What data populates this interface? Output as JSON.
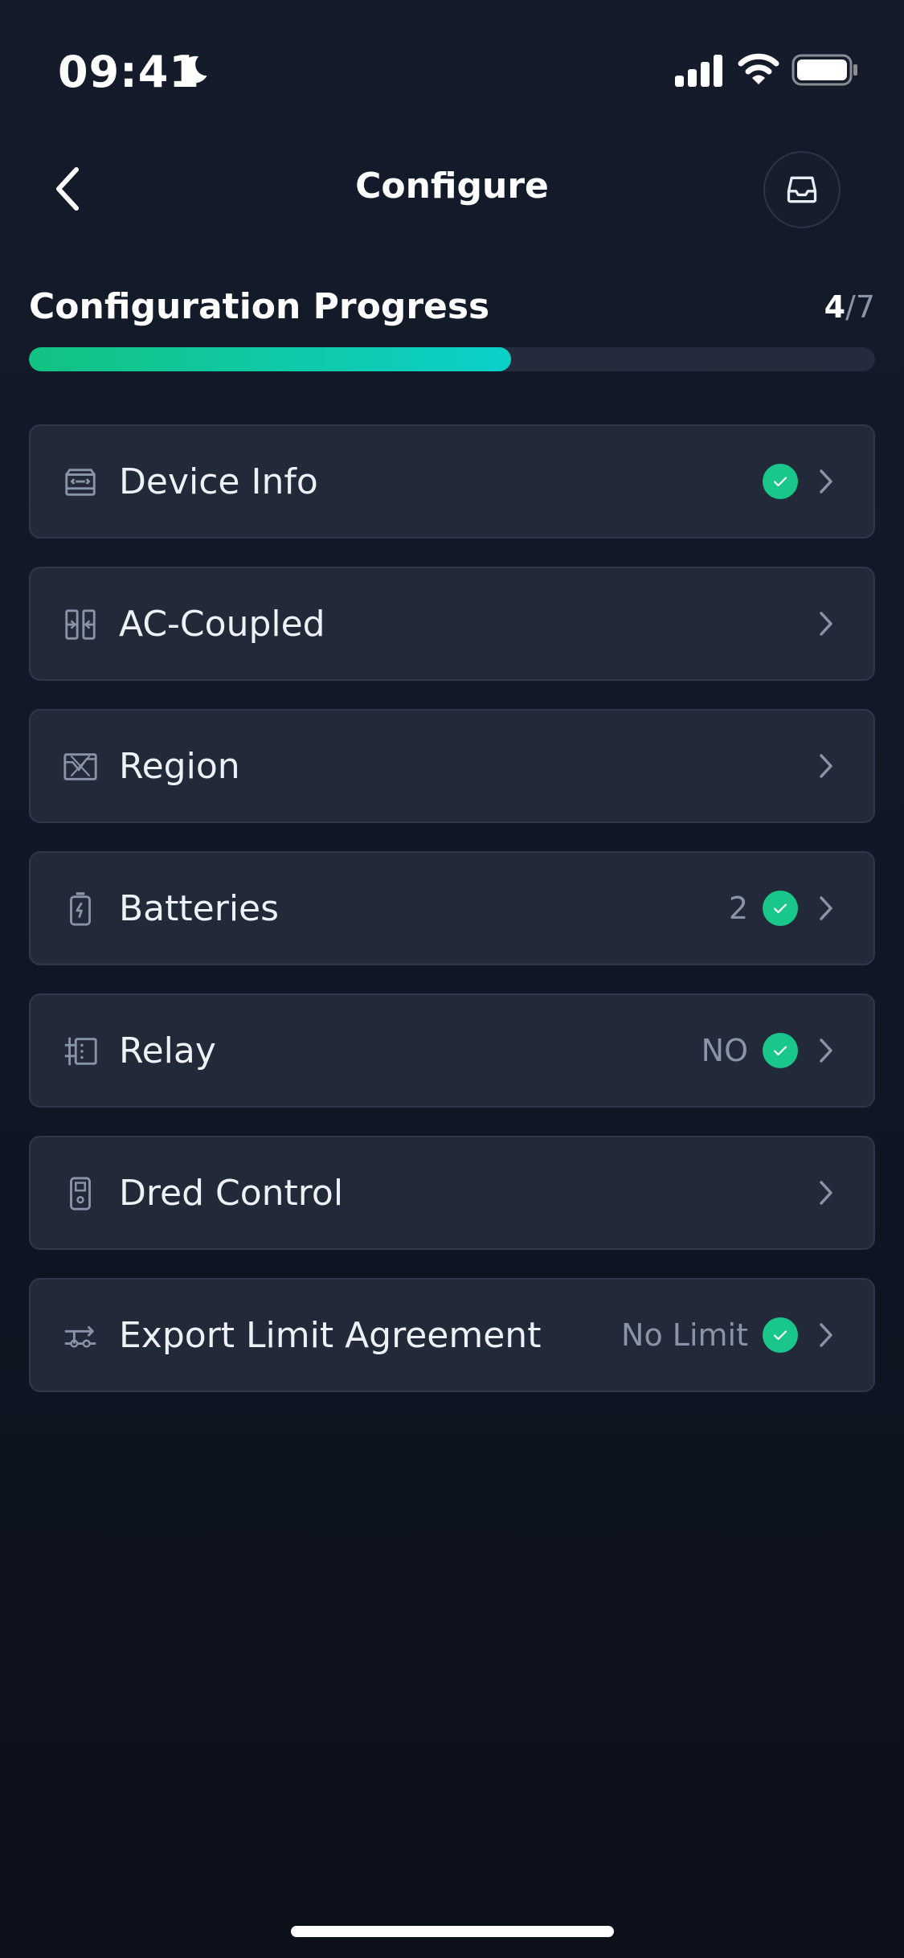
{
  "status_bar": {
    "time": "09:41",
    "icons": [
      "moon-icon",
      "cellular-signal-icon",
      "wifi-icon",
      "battery-icon"
    ]
  },
  "nav": {
    "title": "Configure",
    "back_icon": "chevron-left-icon",
    "action_icon": "inbox-icon"
  },
  "progress": {
    "label": "Configuration Progress",
    "current": "4",
    "total": "/7",
    "fraction": 0.57
  },
  "items": [
    {
      "label": "Device Info",
      "value": "",
      "icon": "device-info-icon",
      "done": true
    },
    {
      "label": "AC-Coupled",
      "value": "",
      "icon": "ac-coupled-icon",
      "done": false
    },
    {
      "label": "Region",
      "value": "",
      "icon": "region-map-icon",
      "done": false
    },
    {
      "label": "Batteries",
      "value": "2",
      "icon": "battery-charge-icon",
      "done": true
    },
    {
      "label": "Relay",
      "value": "NO",
      "icon": "relay-icon",
      "done": true
    },
    {
      "label": "Dred Control",
      "value": "",
      "icon": "dred-control-icon",
      "done": false
    },
    {
      "label": "Export Limit Agreement",
      "value": "No Limit",
      "icon": "export-limit-icon",
      "done": true
    }
  ],
  "colors": {
    "background": "#111726",
    "card": "#222a3a",
    "accent_green": "#12c281",
    "accent_teal": "#0bd0c9",
    "check": "#19c78a",
    "muted_text": "#8a94a8"
  }
}
